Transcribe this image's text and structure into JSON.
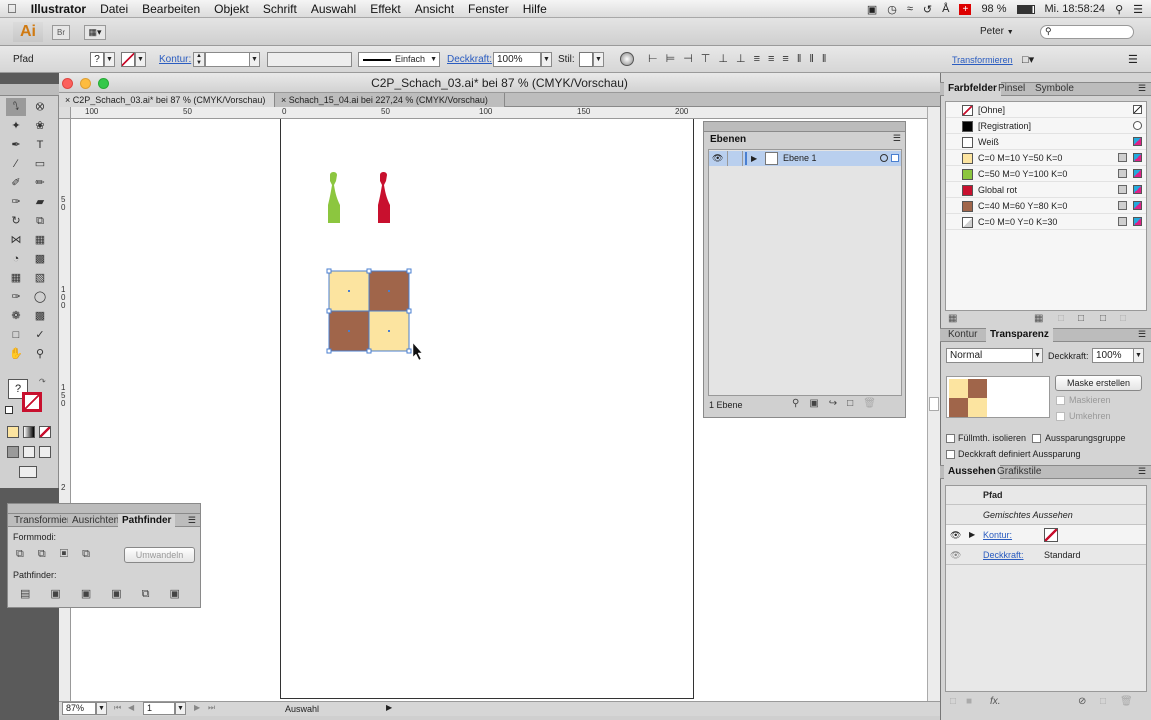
{
  "menubar": {
    "apple": "",
    "app_name": "Illustrator",
    "items": [
      "Datei",
      "Bearbeiten",
      "Objekt",
      "Schrift",
      "Auswahl",
      "Effekt",
      "Ansicht",
      "Fenster",
      "Hilfe"
    ],
    "battery": "98 %",
    "clock": "Mi. 18:58:24"
  },
  "appbar": {
    "logo": "Ai",
    "bridge": "Br",
    "workspace": "Peter",
    "search_placeholder": ""
  },
  "control": {
    "object_type": "Pfad",
    "stroke_label": "Kontur:",
    "stroke_style": "Einfach",
    "opacity_label": "Deckkraft:",
    "opacity_value": "100%",
    "style_label": "Stil:",
    "transform_label": "Transformieren"
  },
  "document": {
    "window_title": "C2P_Schach_03.ai* bei 87 % (CMYK/Vorschau)",
    "tabs": [
      {
        "label": "C2P_Schach_03.ai* bei 87 % (CMYK/Vorschau)",
        "active": true
      },
      {
        "label": "Schach_15_04.ai bei 227,24 % (CMYK/Vorschau)",
        "active": false
      }
    ],
    "ruler_h": [
      "100",
      "50",
      "0",
      "50",
      "100",
      "150",
      "200"
    ],
    "ruler_v": [
      "5",
      "0",
      "1",
      "0",
      "0",
      "1",
      "5",
      "0",
      "2"
    ],
    "zoom": "87%",
    "artboard_num": "1",
    "status_tool": "Auswahl"
  },
  "artwork": {
    "pawn_green": "#8cc63f",
    "pawn_red": "#c8102e",
    "light_square": "#fce4a0",
    "dark_square": "#a0654a",
    "selection_color": "#4a7fd0"
  },
  "layers_panel": {
    "title": "Ebenen",
    "layer_name": "Ebene 1",
    "footer": "1 Ebene"
  },
  "pathfinder_panel": {
    "tabs": [
      "Transformieren",
      "Ausrichten",
      "Pathfinder"
    ],
    "shape_modes_label": "Formmodi:",
    "expand_button": "Umwandeln",
    "pathfinders_label": "Pathfinder:"
  },
  "swatches_panel": {
    "tabs": [
      "Farbfelder",
      "Pinsel",
      "Symbole"
    ],
    "swatches": [
      {
        "name": "[Ohne]",
        "color": "#ffffff"
      },
      {
        "name": "[Registration]",
        "color": "#000000"
      },
      {
        "name": "Weiß",
        "color": "#ffffff"
      },
      {
        "name": "C=0 M=10 Y=50 K=0",
        "color": "#fce4a0"
      },
      {
        "name": "C=50 M=0 Y=100 K=0",
        "color": "#8cc63f"
      },
      {
        "name": "Global rot",
        "color": "#c8102e"
      },
      {
        "name": "C=40 M=60 Y=80 K=0",
        "color": "#a0654a"
      },
      {
        "name": "C=0 M=0 Y=0 K=30",
        "color": "#cfcfcf"
      }
    ]
  },
  "transparency_panel": {
    "tabs": [
      "Kontur",
      "Transparenz"
    ],
    "blend_mode": "Normal",
    "opacity_label": "Deckkraft:",
    "opacity_value": "100%",
    "make_mask_button": "Maske erstellen",
    "clip_label": "Maskieren",
    "invert_label": "Umkehren",
    "isolate_label": "Füllmth. isolieren",
    "knockout_label": "Aussparungsgruppe",
    "opacity_mask_label": "Deckkraft definiert Aussparung"
  },
  "appearance_panel": {
    "tabs": [
      "Aussehen",
      "Grafikstile"
    ],
    "target": "Pfad",
    "mixed": "Gemischtes Aussehen",
    "stroke_label": "Kontur:",
    "opacity_label": "Deckkraft:",
    "opacity_value": "Standard"
  }
}
